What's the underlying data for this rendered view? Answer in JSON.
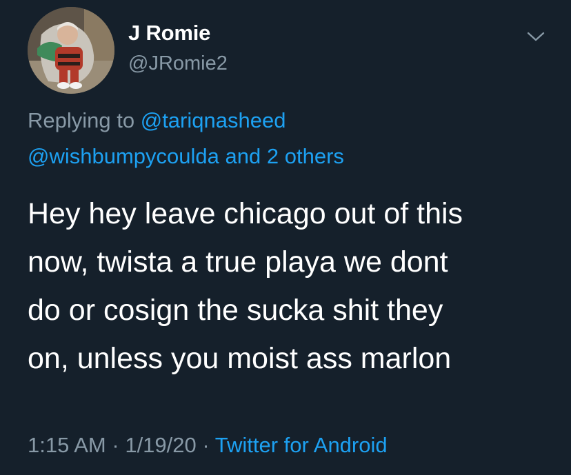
{
  "tweet": {
    "display_name": "J Romie",
    "handle": "@JRomie2",
    "reply": {
      "prefix": "Replying to",
      "mention1": "@tariqnasheed",
      "mention2": "@wishbumpycoulda",
      "and_text": "and",
      "others": "2 others"
    },
    "body_lines": [
      "Hey hey leave chicago out of this",
      "now, twista a true playa we dont",
      "do or cosign the sucka shit they",
      "on, unless you moist ass marlon"
    ],
    "time": "1:15 AM",
    "separator": "·",
    "date": "1/19/20",
    "source": "Twitter for Android"
  },
  "icons": {
    "avatar": "avatar-photo",
    "menu": "chevron-down-icon"
  },
  "colors": {
    "background": "#15202b",
    "primary_text": "#ffffff",
    "secondary_text": "#8899a6",
    "link": "#1da1f2"
  }
}
